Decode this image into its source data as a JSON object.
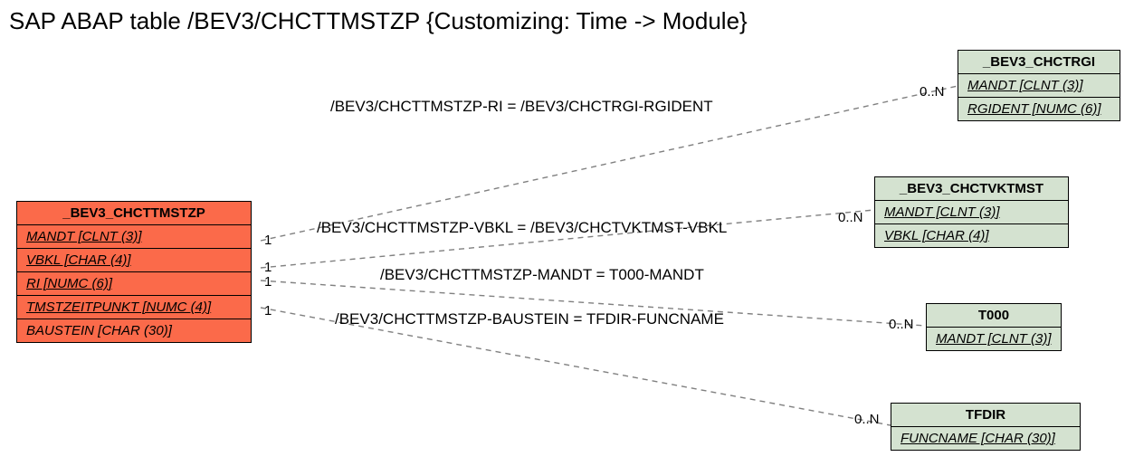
{
  "title": "SAP ABAP table /BEV3/CHCTTMSTZP {Customizing: Time -> Module}",
  "main": {
    "name": "_BEV3_CHCTTMSTZP",
    "fields": [
      {
        "label": "MANDT [CLNT (3)]",
        "key": true
      },
      {
        "label": "VBKL [CHAR (4)]",
        "key": true
      },
      {
        "label": "RI [NUMC (6)]",
        "key": true
      },
      {
        "label": "TMSTZEITPUNKT [NUMC (4)]",
        "key": true
      },
      {
        "label": "BAUSTEIN [CHAR (30)]",
        "key": false
      }
    ]
  },
  "refs": {
    "chctrgi": {
      "name": "_BEV3_CHCTRGI",
      "fields": [
        {
          "label": "MANDT [CLNT (3)]",
          "key": true
        },
        {
          "label": "RGIDENT [NUMC (6)]",
          "key": true
        }
      ]
    },
    "chctvktmst": {
      "name": "_BEV3_CHCTVKTMST",
      "fields": [
        {
          "label": "MANDT [CLNT (3)]",
          "key": true
        },
        {
          "label": "VBKL [CHAR (4)]",
          "key": true
        }
      ]
    },
    "t000": {
      "name": "T000",
      "fields": [
        {
          "label": "MANDT [CLNT (3)]",
          "key": true
        }
      ]
    },
    "tfdir": {
      "name": "TFDIR",
      "fields": [
        {
          "label": "FUNCNAME [CHAR (30)]",
          "key": true
        }
      ]
    }
  },
  "relations": {
    "r1": "/BEV3/CHCTTMSTZP-RI = /BEV3/CHCTRGI-RGIDENT",
    "r2": "/BEV3/CHCTTMSTZP-VBKL = /BEV3/CHCTVKTMST-VBKL",
    "r3": "/BEV3/CHCTTMSTZP-MANDT = T000-MANDT",
    "r4": "/BEV3/CHCTTMSTZP-BAUSTEIN = TFDIR-FUNCNAME"
  },
  "card": {
    "one": "1",
    "many": "0..N"
  }
}
